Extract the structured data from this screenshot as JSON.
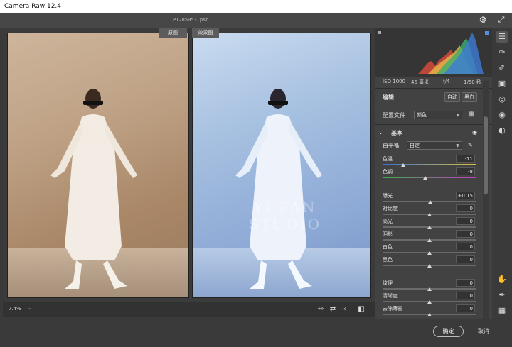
{
  "window": {
    "title": "Camera Raw 12.4"
  },
  "file": {
    "name": "P1285053.psd"
  },
  "view": {
    "before_label": "原图",
    "after_label": "效果图",
    "watermark": "YUFAN STUDIO"
  },
  "bottom": {
    "zoom": "7.4%"
  },
  "camera": {
    "iso": "ISO 1000",
    "focal": "45 毫米",
    "aperture": "f/4",
    "shutter": "1/50 秒"
  },
  "edit": {
    "title": "编辑",
    "auto_label": "自动",
    "bw_label": "黑白",
    "profile_label": "配置文件",
    "profile_value": "颜色",
    "basic_title": "基本",
    "wb_label": "白平衡",
    "wb_value": "自定"
  },
  "sliders": {
    "temp": {
      "label": "色温",
      "value": "-71",
      "pos": 0.22
    },
    "tint": {
      "label": "色调",
      "value": "-8",
      "pos": 0.46
    },
    "exposure": {
      "label": "曝光",
      "value": "+0.15",
      "pos": 0.51
    },
    "contrast": {
      "label": "对比度",
      "value": "0",
      "pos": 0.5
    },
    "highlights": {
      "label": "高光",
      "value": "0",
      "pos": 0.5
    },
    "shadows": {
      "label": "阴影",
      "value": "0",
      "pos": 0.5
    },
    "whites": {
      "label": "白色",
      "value": "0",
      "pos": 0.5
    },
    "blacks": {
      "label": "黑色",
      "value": "0",
      "pos": 0.5
    },
    "texture": {
      "label": "纹理",
      "value": "0",
      "pos": 0.5
    },
    "clarity": {
      "label": "清晰度",
      "value": "0",
      "pos": 0.5
    },
    "dehaze": {
      "label": "去除薄雾",
      "value": "0",
      "pos": 0.5
    }
  },
  "footer": {
    "ok_label": "确定",
    "cancel_label": "取消"
  }
}
